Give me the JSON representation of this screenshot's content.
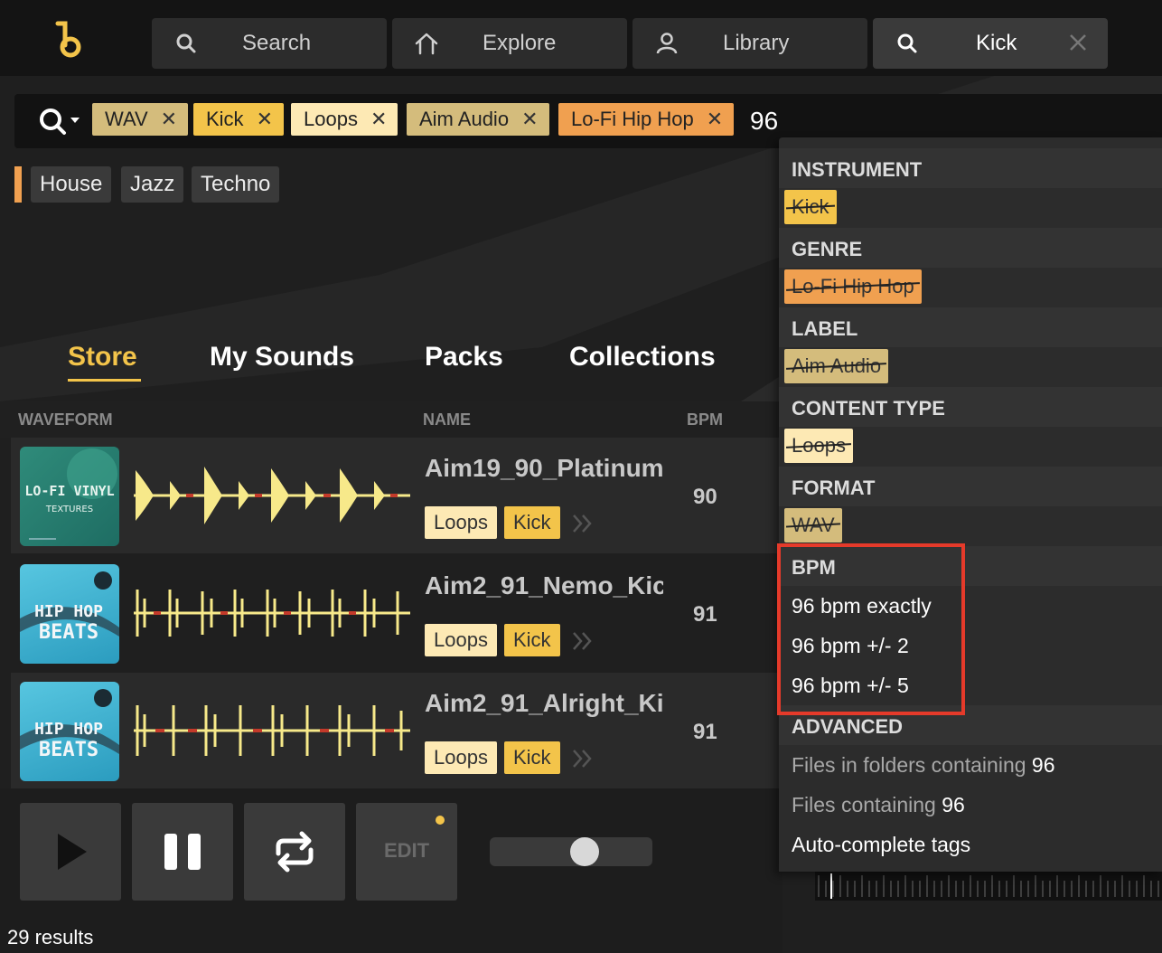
{
  "colors": {
    "accent": "#f3c44a",
    "wav_chip": "#d4bc7c",
    "kick_chip": "#f3c44a",
    "loops_chip": "#fde9b4",
    "aim_chip": "#d4bc7c",
    "lofi_chip": "#f0a050",
    "highlight_box": "#e53a2a"
  },
  "nav": {
    "tabs": [
      {
        "label": "Search",
        "icon": "search-icon"
      },
      {
        "label": "Explore",
        "icon": "home-icon"
      },
      {
        "label": "Library",
        "icon": "user-icon"
      },
      {
        "label": "Kick",
        "icon": "search-icon",
        "active": true
      }
    ]
  },
  "search": {
    "chips": [
      "WAV",
      "Kick",
      "Loops",
      "Aim Audio",
      "Lo-Fi Hip Hop"
    ],
    "query": "96",
    "close_glyph": "✕"
  },
  "genre_suggestions": [
    "House",
    "Jazz",
    "Techno"
  ],
  "section_tabs": [
    "Store",
    "My Sounds",
    "Packs",
    "Collections"
  ],
  "table": {
    "headers": {
      "waveform": "WAVEFORM",
      "name": "NAME",
      "bpm": "BPM"
    },
    "rows": [
      {
        "name": "Aim19_90_Platinum",
        "bpm": "90",
        "tags": [
          "Loops",
          "Kick"
        ],
        "cover_title": "LO-FI VINYL",
        "cover_sub": "TEXTURES"
      },
      {
        "name": "Aim2_91_Nemo_Kic",
        "bpm": "91",
        "tags": [
          "Loops",
          "Kick"
        ],
        "cover_title": "HIP HOP",
        "cover_sub": "BEATS"
      },
      {
        "name": "Aim2_91_Alright_Ki",
        "bpm": "91",
        "tags": [
          "Loops",
          "Kick"
        ],
        "cover_title": "HIP HOP",
        "cover_sub": "BEATS"
      }
    ]
  },
  "player": {
    "edit_label": "EDIT",
    "slider_level": 0.6
  },
  "results": "29 results",
  "dropdown": {
    "sections": {
      "instrument": {
        "title": "INSTRUMENT",
        "tag": "Kick"
      },
      "genre": {
        "title": "GENRE",
        "tag": "Lo-Fi Hip Hop"
      },
      "label": {
        "title": "LABEL",
        "tag": "Aim Audio"
      },
      "content_type": {
        "title": "CONTENT TYPE",
        "tag": "Loops"
      },
      "format": {
        "title": "FORMAT",
        "tag": "WAV"
      },
      "bpm": {
        "title": "BPM",
        "items": [
          "96 bpm exactly",
          "96 bpm +/- 2",
          "96 bpm +/- 5"
        ]
      },
      "advanced": {
        "title": "ADVANCED",
        "folders_prefix": "Files in folders containing",
        "files_prefix": "Files containing",
        "query": "96",
        "autocomplete": "Auto-complete tags"
      }
    }
  }
}
